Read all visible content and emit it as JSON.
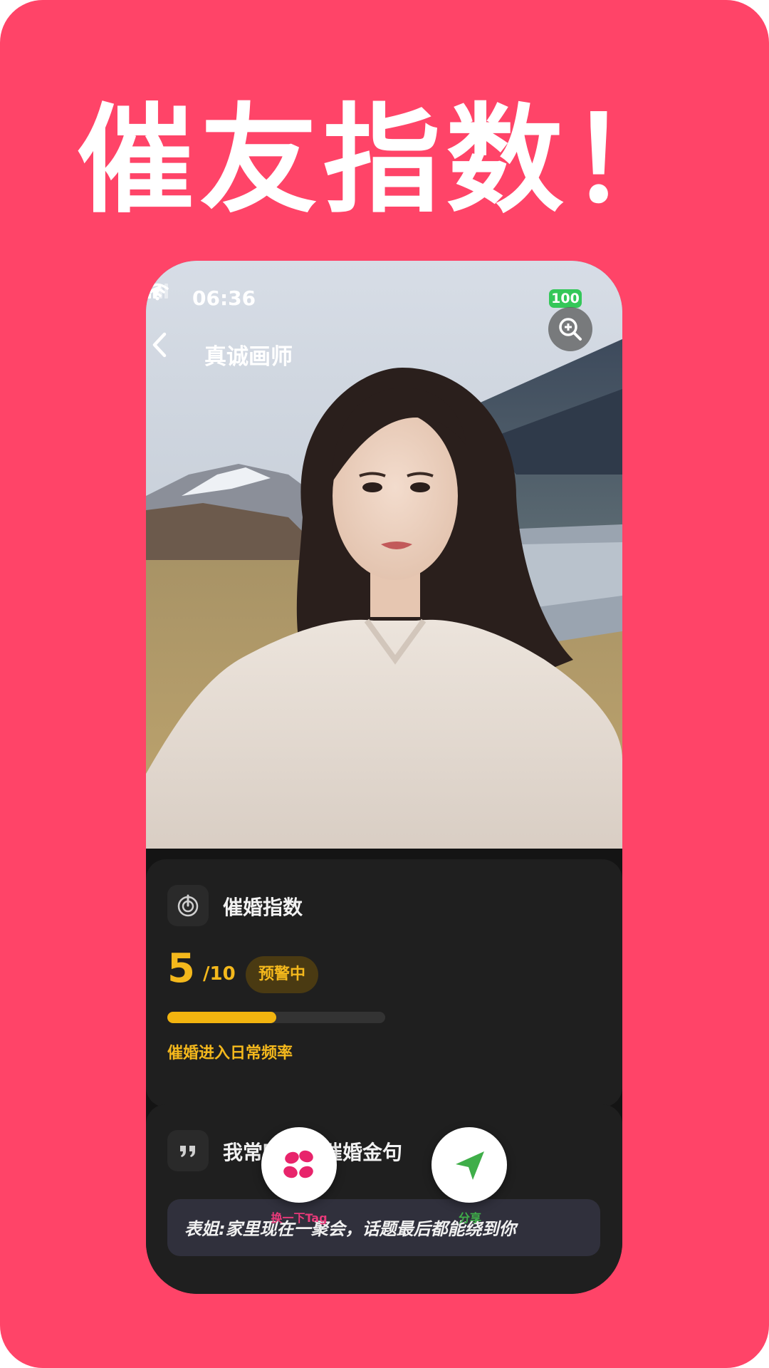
{
  "headline": "催友指数！",
  "status_bar": {
    "time": "06:36",
    "battery": "100",
    "location_icon": "location-arrow-icon",
    "signal_icon": "cellular-signal-icon",
    "wifi_icon": "wifi-icon"
  },
  "nav": {
    "title": "真诚画师",
    "back_icon": "chevron-left-icon",
    "zoom_icon": "zoom-in-icon"
  },
  "marriage_index_card": {
    "icon": "target-icon",
    "title": "催婚指数",
    "score": "5",
    "score_max": "/10",
    "status": "预警中",
    "progress": 0.5,
    "note": "催婚进入日常频率"
  },
  "quote_card": {
    "icon": "quote-icon",
    "title": "我常听到的催婚金句",
    "quote": "表姐:家里现在一聚会，话题最后都能绕到你"
  },
  "actions": {
    "left_icon": "flower-icon",
    "left_label": "换一下Tag",
    "right_icon": "send-icon",
    "right_label": "分享"
  },
  "colors": {
    "background": "#ff4468",
    "accent_yellow": "#f4b81c",
    "card": "#1f1f1f",
    "left_action": "#e83a7a",
    "right_action": "#3fae49"
  }
}
